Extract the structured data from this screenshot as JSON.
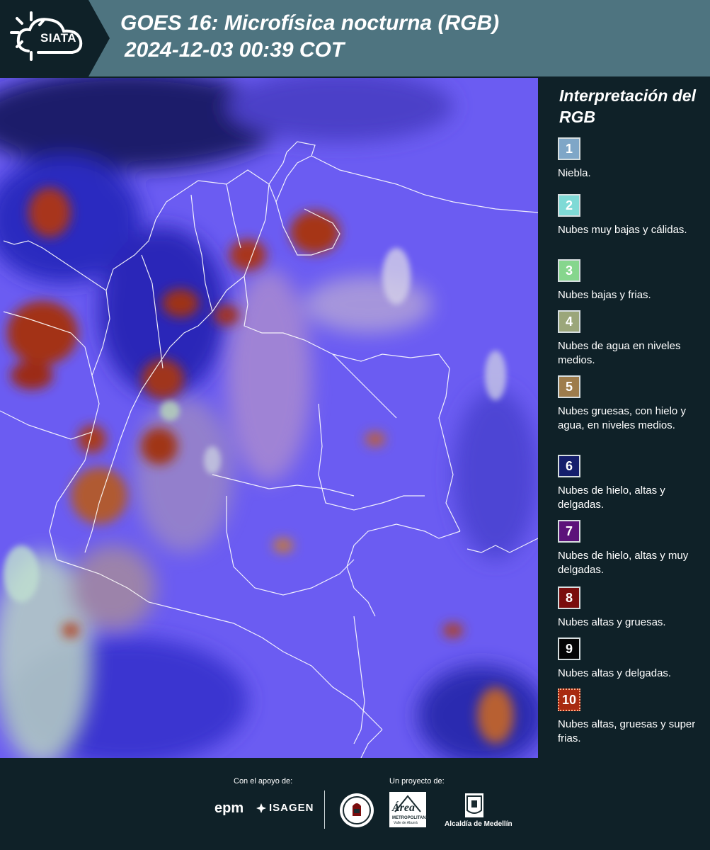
{
  "header": {
    "logo_text": "SIATA",
    "title_line1": "GOES 16: Microfísica nocturna (RGB)",
    "title_line2": "2024-12-03 00:39 COT"
  },
  "legend": {
    "title": "Interpretación del RGB",
    "items": [
      {
        "number": "1",
        "text": "Niebla.",
        "color": "#7fa6c7"
      },
      {
        "number": "2",
        "text": "Nubes muy bajas y cálidas.",
        "color": "#7fdad6"
      },
      {
        "number": "3",
        "text": "Nubes bajas y frias.",
        "color": "#86d68d"
      },
      {
        "number": "4",
        "text": "Nubes de agua en niveles medios.",
        "color": "#9ba67a"
      },
      {
        "number": "5",
        "text": "Nubes gruesas, con hielo y agua, en niveles medios.",
        "color": "#9e7c4c"
      },
      {
        "number": "6",
        "text": "Nubes de hielo, altas y delgadas.",
        "color": "#151e6c"
      },
      {
        "number": "7",
        "text": "Nubes de hielo, altas y muy delgadas.",
        "color": "#5c127a"
      },
      {
        "number": "8",
        "text": "Nubes altas y gruesas.",
        "color": "#7a0d0d"
      },
      {
        "number": "9",
        "text": "Nubes altas y delgadas.",
        "color": "#050505"
      },
      {
        "number": "10",
        "text": "Nubes altas, gruesas y super frias.",
        "color": "#a82a10"
      }
    ]
  },
  "footer": {
    "support_label": "Con el apoyo de:",
    "project_label": "Un proyecto de:",
    "epm_text": "epm",
    "isagen_text": "ISAGEN",
    "area_text": "Área",
    "area_subtext": "METROPOLITANA",
    "area_subtext2": "Valle de Aburrá",
    "medellin_text": "Alcaldía de Medellín"
  }
}
